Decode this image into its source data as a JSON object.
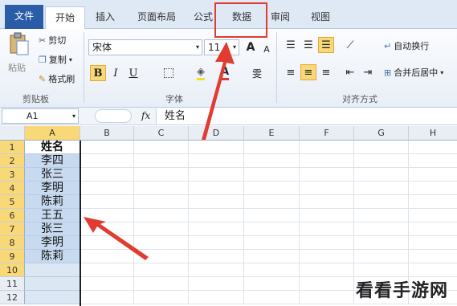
{
  "tabs": [
    {
      "label": "文件"
    },
    {
      "label": "开始"
    },
    {
      "label": "插入"
    },
    {
      "label": "页面布局"
    },
    {
      "label": "公式"
    },
    {
      "label": "数据"
    },
    {
      "label": "审阅"
    },
    {
      "label": "视图"
    }
  ],
  "clipboard": {
    "paste": "粘贴",
    "cut": "剪切",
    "copy": "复制",
    "format_painter": "格式刷",
    "group_label": "剪贴板"
  },
  "font": {
    "name": "宋体",
    "size": "11",
    "bold": "B",
    "italic": "I",
    "underline": "U",
    "grow": "A",
    "shrink": "A",
    "font_color": "A",
    "phonetic": "雯",
    "group_label": "字体"
  },
  "alignment": {
    "wrap_text": "自动换行",
    "merge_center": "合并后居中",
    "group_label": "对齐方式"
  },
  "formula_bar": {
    "name_box": "A1",
    "fx": "fx",
    "content": "姓名"
  },
  "sheet": {
    "columns": [
      "A",
      "B",
      "C",
      "D",
      "E",
      "F",
      "G",
      "H"
    ],
    "rows": [
      "1",
      "2",
      "3",
      "4",
      "5",
      "6",
      "7",
      "8",
      "9",
      "10",
      "11",
      "12"
    ],
    "column_a": [
      "姓名",
      "李四",
      "张三",
      "李明",
      "陈莉",
      "王五",
      "张三",
      "李明",
      "陈莉",
      "",
      "",
      ""
    ]
  },
  "watermark": "看看手游网",
  "colors": {
    "accent": "#2a5ca8",
    "annotation": "#e03c31",
    "selection": "#c8daf0"
  }
}
